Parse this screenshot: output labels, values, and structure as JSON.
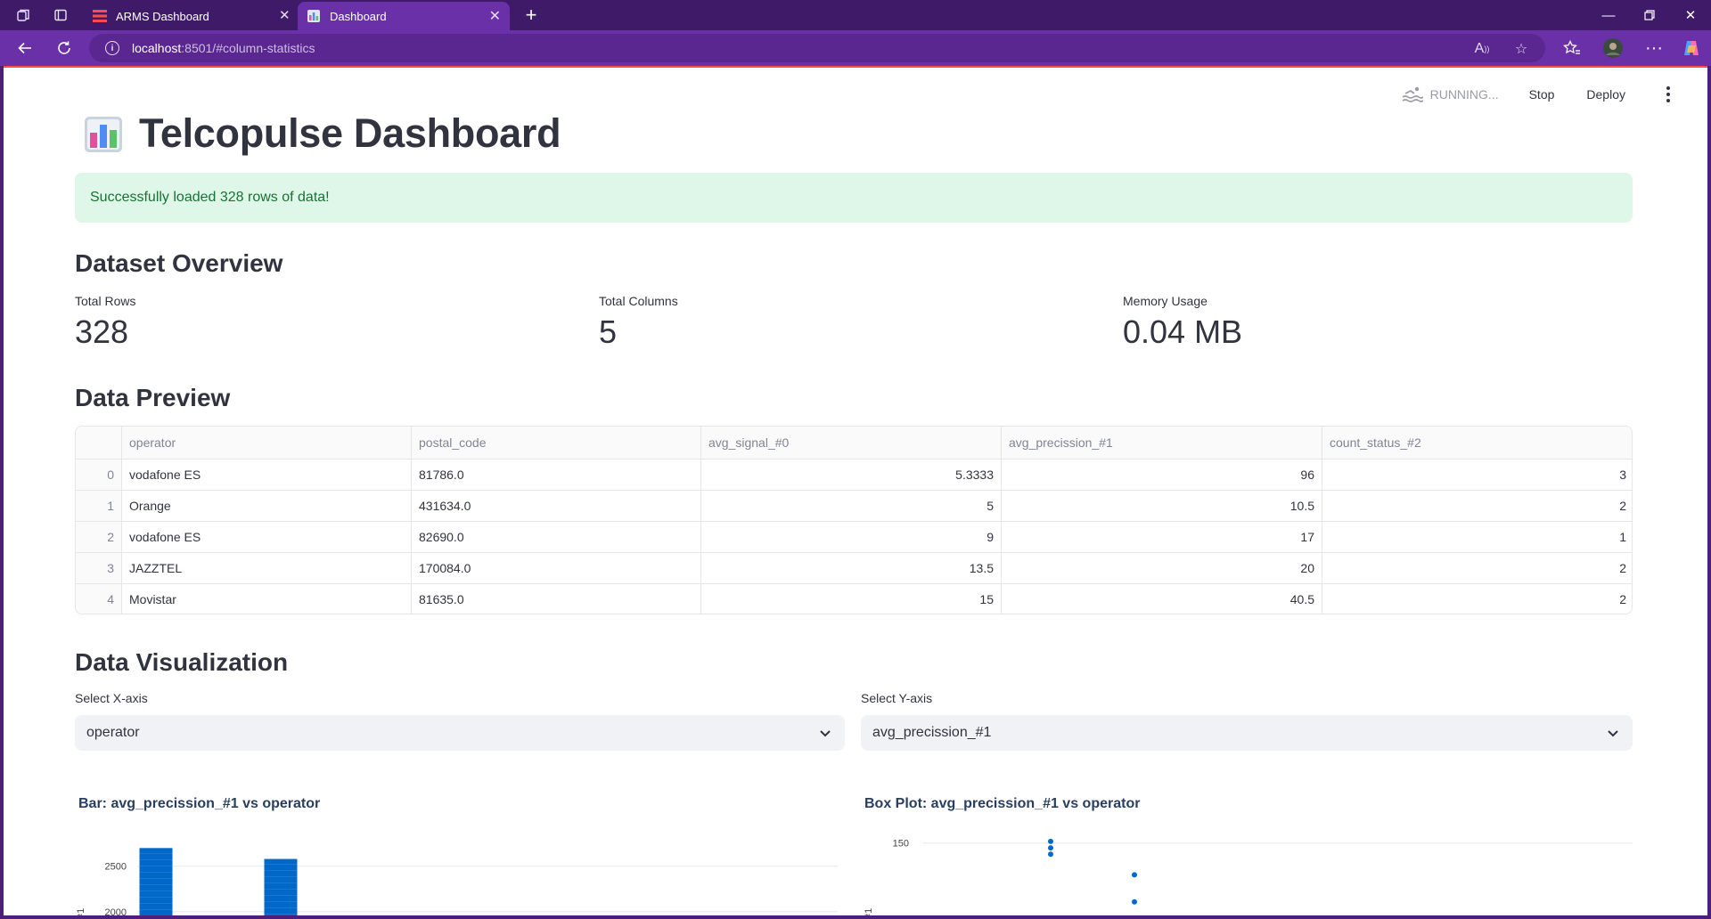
{
  "browser": {
    "tabs": [
      {
        "title": "ARMS Dashboard",
        "active": false
      },
      {
        "title": "Dashboard",
        "active": true
      }
    ],
    "url_host": "localhost",
    "url_path": ":8501/#column-statistics"
  },
  "app_header": {
    "status": "RUNNING...",
    "stop_label": "Stop",
    "deploy_label": "Deploy"
  },
  "page": {
    "title": "Telcopulse Dashboard",
    "success_message": "Successfully loaded 328 rows of data!"
  },
  "overview": {
    "heading": "Dataset Overview",
    "metrics": [
      {
        "label": "Total Rows",
        "value": "328"
      },
      {
        "label": "Total Columns",
        "value": "5"
      },
      {
        "label": "Memory Usage",
        "value": "0.04 MB"
      }
    ]
  },
  "preview": {
    "heading": "Data Preview",
    "columns": [
      "operator",
      "postal_code",
      "avg_signal_#0",
      "avg_precission_#1",
      "count_status_#2"
    ],
    "rows": [
      [
        "0",
        "vodafone ES",
        "81786.0",
        "5.3333",
        "96",
        "3"
      ],
      [
        "1",
        "Orange",
        "431634.0",
        "5",
        "10.5",
        "2"
      ],
      [
        "2",
        "vodafone ES",
        "82690.0",
        "9",
        "17",
        "1"
      ],
      [
        "3",
        "JAZZTEL",
        "170084.0",
        "13.5",
        "20",
        "2"
      ],
      [
        "4",
        "Movistar",
        "81635.0",
        "15",
        "40.5",
        "2"
      ]
    ]
  },
  "visualization": {
    "heading": "Data Visualization",
    "x_select": {
      "label": "Select X-axis",
      "value": "operator"
    },
    "y_select": {
      "label": "Select Y-axis",
      "value": "avg_precission_#1"
    }
  },
  "chart_data": [
    {
      "type": "bar",
      "title": "Bar: avg_precission_#1 vs operator",
      "xlabel": "",
      "ylabel": "#1",
      "y_ticks": [
        2000,
        2500
      ],
      "values": [
        2700,
        2580
      ],
      "color": "#0068c9"
    },
    {
      "type": "scatter",
      "title": "Box Plot: avg_precission_#1 vs operator",
      "xlabel": "",
      "ylabel": "#1",
      "y_ticks": [
        150
      ],
      "points": [
        {
          "group": 0,
          "y": 151
        },
        {
          "group": 0,
          "y": 147
        },
        {
          "group": 0,
          "y": 143
        },
        {
          "group": 1,
          "y": 130
        },
        {
          "group": 1,
          "y": 113
        }
      ],
      "color": "#0068c9"
    }
  ]
}
